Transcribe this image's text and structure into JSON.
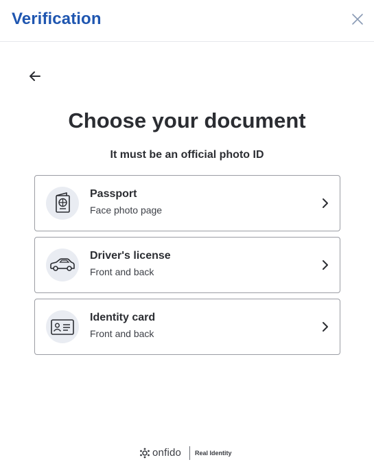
{
  "header": {
    "title": "Verification"
  },
  "main": {
    "title": "Choose your document",
    "subtitle": "It must be an official photo ID"
  },
  "options": [
    {
      "title": "Passport",
      "subtitle": "Face photo page",
      "icon": "passport-icon"
    },
    {
      "title": "Driver's license",
      "subtitle": "Front and back",
      "icon": "car-icon"
    },
    {
      "title": "Identity card",
      "subtitle": "Front and back",
      "icon": "id-card-icon"
    }
  ],
  "footer": {
    "brand": "onfido",
    "tagline": "Real Identity"
  },
  "colors": {
    "brand_blue": "#1f56b0",
    "icon_bg": "#e9ecf2",
    "border": "#9a9ca3",
    "text": "#2b2d32"
  }
}
